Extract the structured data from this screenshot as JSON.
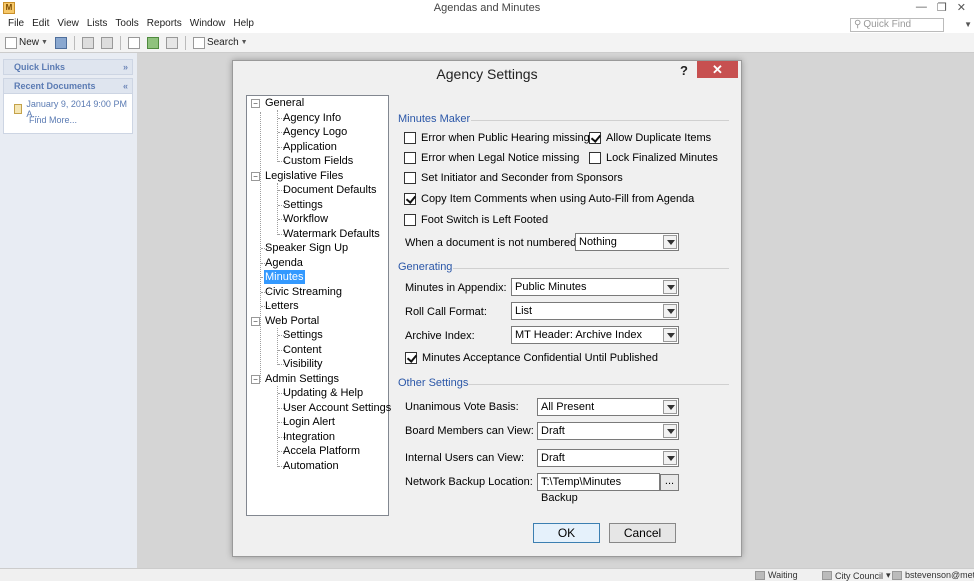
{
  "app": {
    "title": "Agendas and Minutes",
    "icon_letter": "M",
    "menu": [
      "File",
      "Edit",
      "View",
      "Lists",
      "Tools",
      "Reports",
      "Window",
      "Help"
    ],
    "toolbar": {
      "new_label": "New",
      "search_label": "Search"
    },
    "quick_find_placeholder": "Quick Find"
  },
  "left_panel": {
    "quick_links_label": "Quick Links",
    "recent_documents_label": "Recent Documents",
    "recent_doc_entry": "January 9, 2014 9:00 PM A...",
    "find_more_label": "Find More..."
  },
  "status_bar": {
    "status": "Waiting",
    "board": "City Council",
    "user": "bstevenson@metr..."
  },
  "dialog": {
    "title": "Agency Settings",
    "help_glyph": "?",
    "close_glyph": "✕",
    "tree": {
      "general": "General",
      "agency_info": "Agency Info",
      "agency_logo": "Agency Logo",
      "application": "Application",
      "custom_fields": "Custom Fields",
      "legislative_files": "Legislative Files",
      "document_defaults": "Document Defaults",
      "leg_settings": "Settings",
      "workflow": "Workflow",
      "watermark_defaults": "Watermark Defaults",
      "speaker_sign_up": "Speaker Sign Up",
      "agenda": "Agenda",
      "minutes": "Minutes",
      "civic_streaming": "Civic Streaming",
      "letters": "Letters",
      "web_portal": "Web Portal",
      "wp_settings": "Settings",
      "content": "Content",
      "visibility": "Visibility",
      "admin_settings": "Admin Settings",
      "updating_help": "Updating & Help",
      "user_account_settings": "User Account Settings",
      "login_alert": "Login Alert",
      "integration": "Integration",
      "accela_platform": "Accela Platform",
      "automation": "Automation"
    },
    "minutes_maker": {
      "heading": "Minutes Maker",
      "error_public_hearing": {
        "label": "Error when Public Hearing missing",
        "checked": false
      },
      "allow_duplicate": {
        "label": "Allow Duplicate Items",
        "checked": true
      },
      "error_legal_notice": {
        "label": "Error when Legal Notice missing",
        "checked": false
      },
      "lock_finalized": {
        "label": "Lock Finalized Minutes",
        "checked": false
      },
      "set_initiator": {
        "label": "Set Initiator and Seconder from Sponsors",
        "checked": false
      },
      "copy_item_comments": {
        "label": "Copy Item Comments when using Auto-Fill from Agenda",
        "checked": true
      },
      "foot_switch": {
        "label": "Foot Switch is Left Footed",
        "checked": false
      },
      "not_numbered_label": "When a document is not numbered",
      "not_numbered_value": "Nothing"
    },
    "generating": {
      "heading": "Generating",
      "minutes_in_appendix_label": "Minutes in Appendix:",
      "minutes_in_appendix_value": "Public Minutes",
      "roll_call_label": "Roll Call Format:",
      "roll_call_value": "List",
      "archive_index_label": "Archive Index:",
      "archive_index_value": "MT Header: Archive Index",
      "confidential": {
        "label": "Minutes Acceptance Confidential Until Published",
        "checked": true
      }
    },
    "other_settings": {
      "heading": "Other Settings",
      "unanimous_label": "Unanimous Vote Basis:",
      "unanimous_value": "All Present",
      "board_members_label": "Board Members can View:",
      "board_members_value": "Draft",
      "internal_users_label": "Internal Users can View:",
      "internal_users_value": "Draft",
      "network_backup_label": "Network Backup Location:",
      "network_backup_value": "T:\\Temp\\Minutes Backup",
      "browse_label": "..."
    },
    "ok_label": "OK",
    "cancel_label": "Cancel"
  }
}
